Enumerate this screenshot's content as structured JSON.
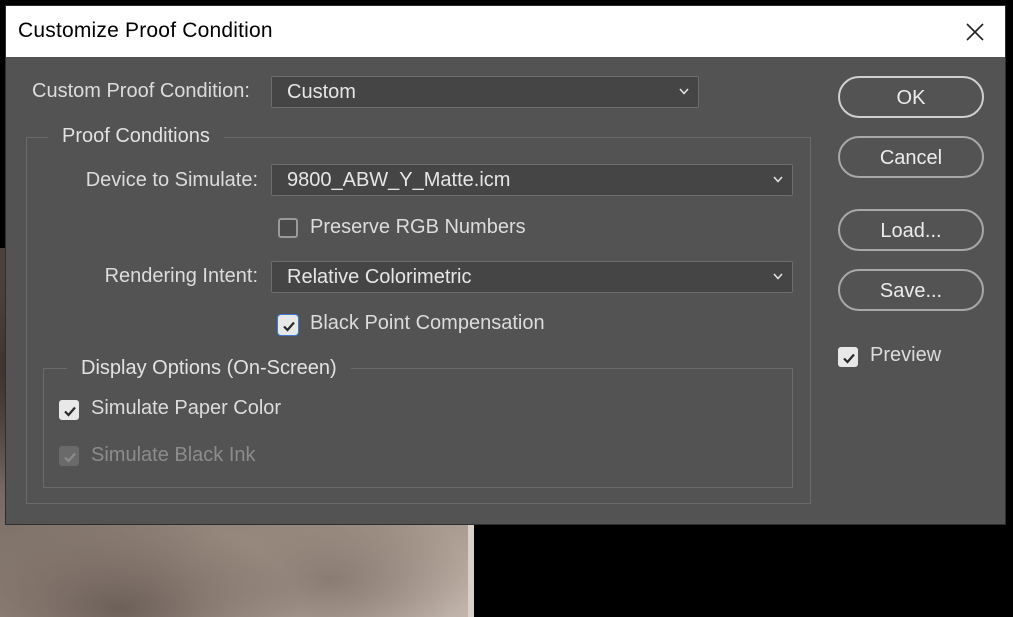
{
  "dialog": {
    "title": "Customize Proof Condition",
    "custom_proof_condition": {
      "label": "Custom Proof Condition:",
      "value": "Custom"
    },
    "proof_conditions": {
      "title": "Proof Conditions",
      "device_to_simulate": {
        "label": "Device to Simulate:",
        "value": "9800_ABW_Y_Matte.icm"
      },
      "preserve_rgb_numbers": {
        "label": "Preserve RGB Numbers",
        "checked": false
      },
      "rendering_intent": {
        "label": "Rendering Intent:",
        "value": "Relative Colorimetric"
      },
      "black_point_compensation": {
        "label": "Black Point Compensation",
        "checked": true
      }
    },
    "display_options": {
      "title": "Display Options (On-Screen)",
      "simulate_paper_color": {
        "label": "Simulate Paper Color",
        "checked": true
      },
      "simulate_black_ink": {
        "label": "Simulate Black Ink",
        "checked": true,
        "disabled": true
      }
    },
    "buttons": {
      "ok": "OK",
      "cancel": "Cancel",
      "load": "Load...",
      "save": "Save..."
    },
    "preview": {
      "label": "Preview",
      "checked": true
    }
  },
  "colors": {
    "dialog_bg": "#535353",
    "title_bg": "#ffffff",
    "focus_accent": "#3d7ad6"
  },
  "icons": {
    "close": "close-icon",
    "dropdown": "chevron-down-icon",
    "check": "checkmark-icon"
  }
}
